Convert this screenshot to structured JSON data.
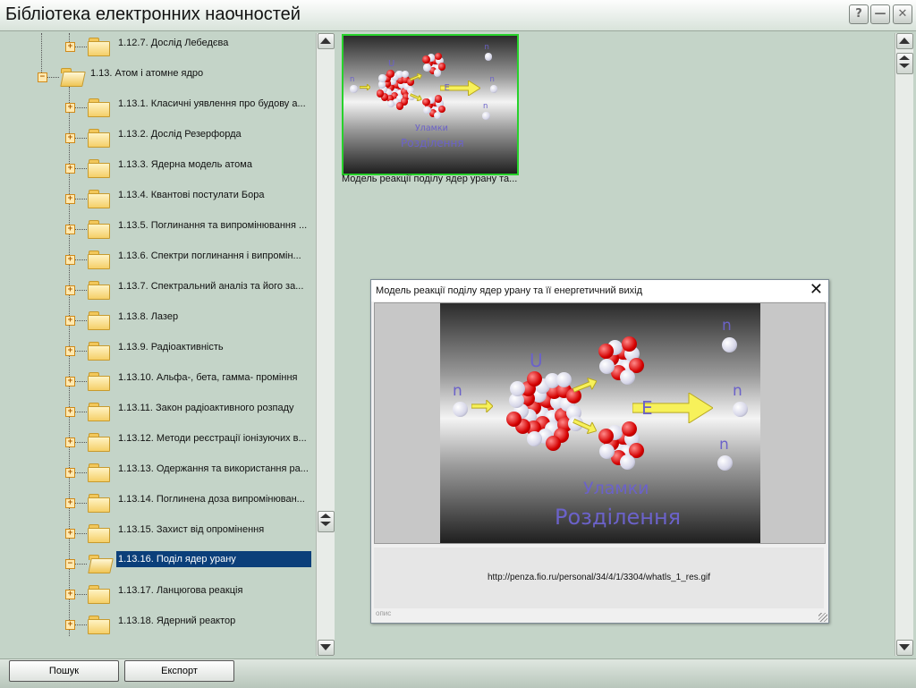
{
  "window": {
    "title": "Бібліотека електронних наочностей",
    "help_label": "?",
    "minimize_label": "—",
    "close_label": "✕"
  },
  "tree": {
    "items": [
      {
        "label": "1.12.7. Дослід Лебедєва",
        "level": 2,
        "expanded": false,
        "selected": false
      },
      {
        "label": "1.13. Атом і атомне ядро",
        "level": 1,
        "expanded": true,
        "selected": false
      },
      {
        "label": "1.13.1. Класичні уявлення про будову а...",
        "level": 2,
        "expanded": false,
        "selected": false
      },
      {
        "label": "1.13.2. Дослід Резерфорда",
        "level": 2,
        "expanded": false,
        "selected": false
      },
      {
        "label": "1.13.3. Ядерна модель атома",
        "level": 2,
        "expanded": false,
        "selected": false
      },
      {
        "label": "1.13.4. Квантові постулати Бора",
        "level": 2,
        "expanded": false,
        "selected": false
      },
      {
        "label": "1.13.5. Поглинання та випромінювання ...",
        "level": 2,
        "expanded": false,
        "selected": false
      },
      {
        "label": "1.13.6. Спектри поглинання і випромін...",
        "level": 2,
        "expanded": false,
        "selected": false
      },
      {
        "label": "1.13.7. Спектральний аналіз та його за...",
        "level": 2,
        "expanded": false,
        "selected": false
      },
      {
        "label": "1.13.8. Лазер",
        "level": 2,
        "expanded": false,
        "selected": false
      },
      {
        "label": "1.13.9. Радіоактивність",
        "level": 2,
        "expanded": false,
        "selected": false
      },
      {
        "label": "1.13.10. Альфа-, бета, гамма- проміння",
        "level": 2,
        "expanded": false,
        "selected": false
      },
      {
        "label": "1.13.11.  Закон радіоактивного розпаду",
        "level": 2,
        "expanded": false,
        "selected": false
      },
      {
        "label": "1.13.12. Методи реєстрації іонізуючих в...",
        "level": 2,
        "expanded": false,
        "selected": false
      },
      {
        "label": "1.13.13. Одержання та використання ра...",
        "level": 2,
        "expanded": false,
        "selected": false
      },
      {
        "label": "1.13.14. Поглинена доза випромінюван...",
        "level": 2,
        "expanded": false,
        "selected": false
      },
      {
        "label": "1.13.15. Захист від опромінення",
        "level": 2,
        "expanded": false,
        "selected": false
      },
      {
        "label": "1.13.16. Поділ ядер урану",
        "level": 2,
        "expanded": true,
        "selected": true
      },
      {
        "label": "1.13.17. Ланцюгова реакція",
        "level": 2,
        "expanded": false,
        "selected": false
      },
      {
        "label": "1.13.18. Ядерний реактор",
        "level": 2,
        "expanded": false,
        "selected": false
      }
    ]
  },
  "thumbnail": {
    "caption": "Модель реакції поділу ядер урану та...",
    "selected_border_color": "#27d22b"
  },
  "atom_image": {
    "neutron_label": "n",
    "uranium_label": "U",
    "energy_label": "E",
    "fragments_label": "Уламки",
    "fission_label": "Розділення",
    "text_color": "#6b62c9",
    "arrow_color": "#f7f15a"
  },
  "popup": {
    "title": "Модель реакції поділу ядер урану та її енергетичний вихід",
    "close_label": "✕",
    "source_url": "http://penza.fio.ru/personal/34/4/1/3304/whatls_1_res.gif",
    "description_label": "опис"
  },
  "bottom": {
    "search_label": "Пошук",
    "export_label": "Експорт"
  },
  "colors": {
    "background": "#c4d4c8",
    "selection": "#0b3f7a"
  }
}
